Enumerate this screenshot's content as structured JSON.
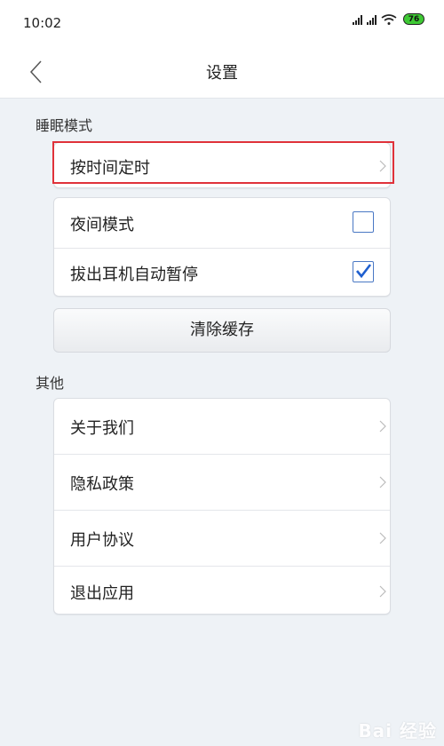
{
  "status_bar": {
    "time": "10:02",
    "battery": "76"
  },
  "header": {
    "title": "设置"
  },
  "sections": {
    "sleep": {
      "label": "睡眠模式",
      "timer_item": {
        "label": "按时间定时"
      },
      "toggles": [
        {
          "label": "夜间模式",
          "checked": false
        },
        {
          "label": "拔出耳机自动暂停",
          "checked": true
        }
      ],
      "clear_cache_label": "清除缓存"
    },
    "other": {
      "label": "其他",
      "items": [
        {
          "label": "关于我们"
        },
        {
          "label": "隐私政策"
        },
        {
          "label": "用户协议"
        },
        {
          "label": "退出应用"
        }
      ]
    }
  },
  "watermark": "Bai 经验",
  "colors": {
    "highlight": "#e0323a",
    "checkbox": "#4a78c4",
    "battery": "#3ec934",
    "background": "#eef2f6"
  }
}
